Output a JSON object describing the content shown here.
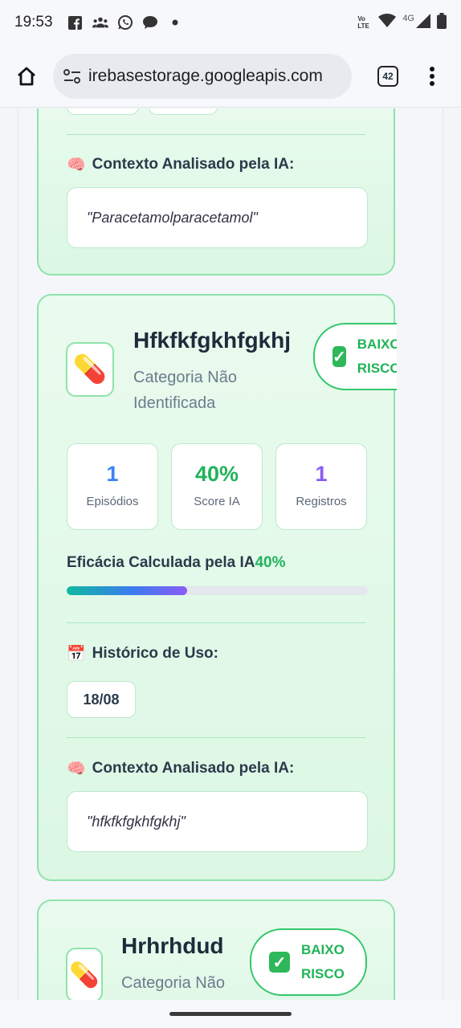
{
  "status_bar": {
    "time": "19:53",
    "network": "4G",
    "volte": "Vo LTE"
  },
  "browser": {
    "url": "irebasestorage.googleapis.com",
    "tab_count": "42"
  },
  "cards": [
    {
      "context_title": "Contexto Analisado pela IA:",
      "context_text": "\"Paracetamolparacetamol\""
    },
    {
      "name": "Hfkfkfgkhfgkhj",
      "category_line1": "Categoria Não",
      "category_line2": "Identificada",
      "risk_line1": "BAIXO",
      "risk_line2": "RISCO",
      "stats": [
        {
          "value": "1",
          "label": "Episódios",
          "color": "#3b82f6"
        },
        {
          "value": "40%",
          "label": "Score IA",
          "color": "#22b35b"
        },
        {
          "value": "1",
          "label": "Registros",
          "color": "#8b5cf6"
        }
      ],
      "efficacy_label": "Eficácia Calculada pela IA",
      "efficacy_value": "40%",
      "efficacy_fraction": 0.4,
      "history_title": "Histórico de Uso:",
      "history_dates": [
        "18/08"
      ],
      "context_title": "Contexto Analisado pela IA:",
      "context_text": "\"hfkfkfgkhfgkhj\""
    },
    {
      "name": "Hrhrhdud",
      "category_line1": "Categoria Não",
      "risk_line1": "BAIXO",
      "risk_line2": "RISCO"
    }
  ],
  "colors": {
    "card_border": "#8fe3ac",
    "accent_green": "#22b35b"
  }
}
